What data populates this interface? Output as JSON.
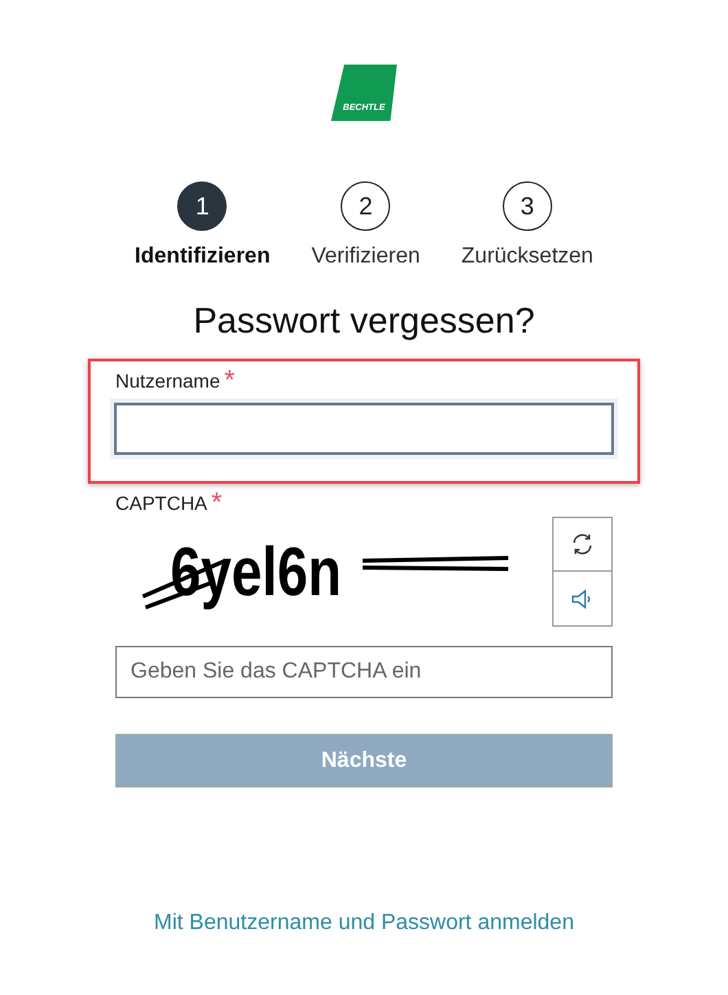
{
  "logo": {
    "text": "BECHTLE"
  },
  "steps": [
    {
      "number": "1",
      "label": "Identifizieren",
      "selected": true
    },
    {
      "number": "2",
      "label": "Verifizieren",
      "selected": false
    },
    {
      "number": "3",
      "label": "Zurücksetzen",
      "selected": false
    }
  ],
  "title": "Passwort vergessen?",
  "username": {
    "label": "Nutzername",
    "required_mark": "*",
    "highlighted": true
  },
  "captcha": {
    "label": "CAPTCHA",
    "required_mark": "*",
    "text": "6yel6n",
    "placeholder": "Geben Sie das CAPTCHA ein"
  },
  "next_button": {
    "label": "Nächste",
    "disabled": true
  },
  "login_link": "Mit Benutzername und Passwort anmelden"
}
